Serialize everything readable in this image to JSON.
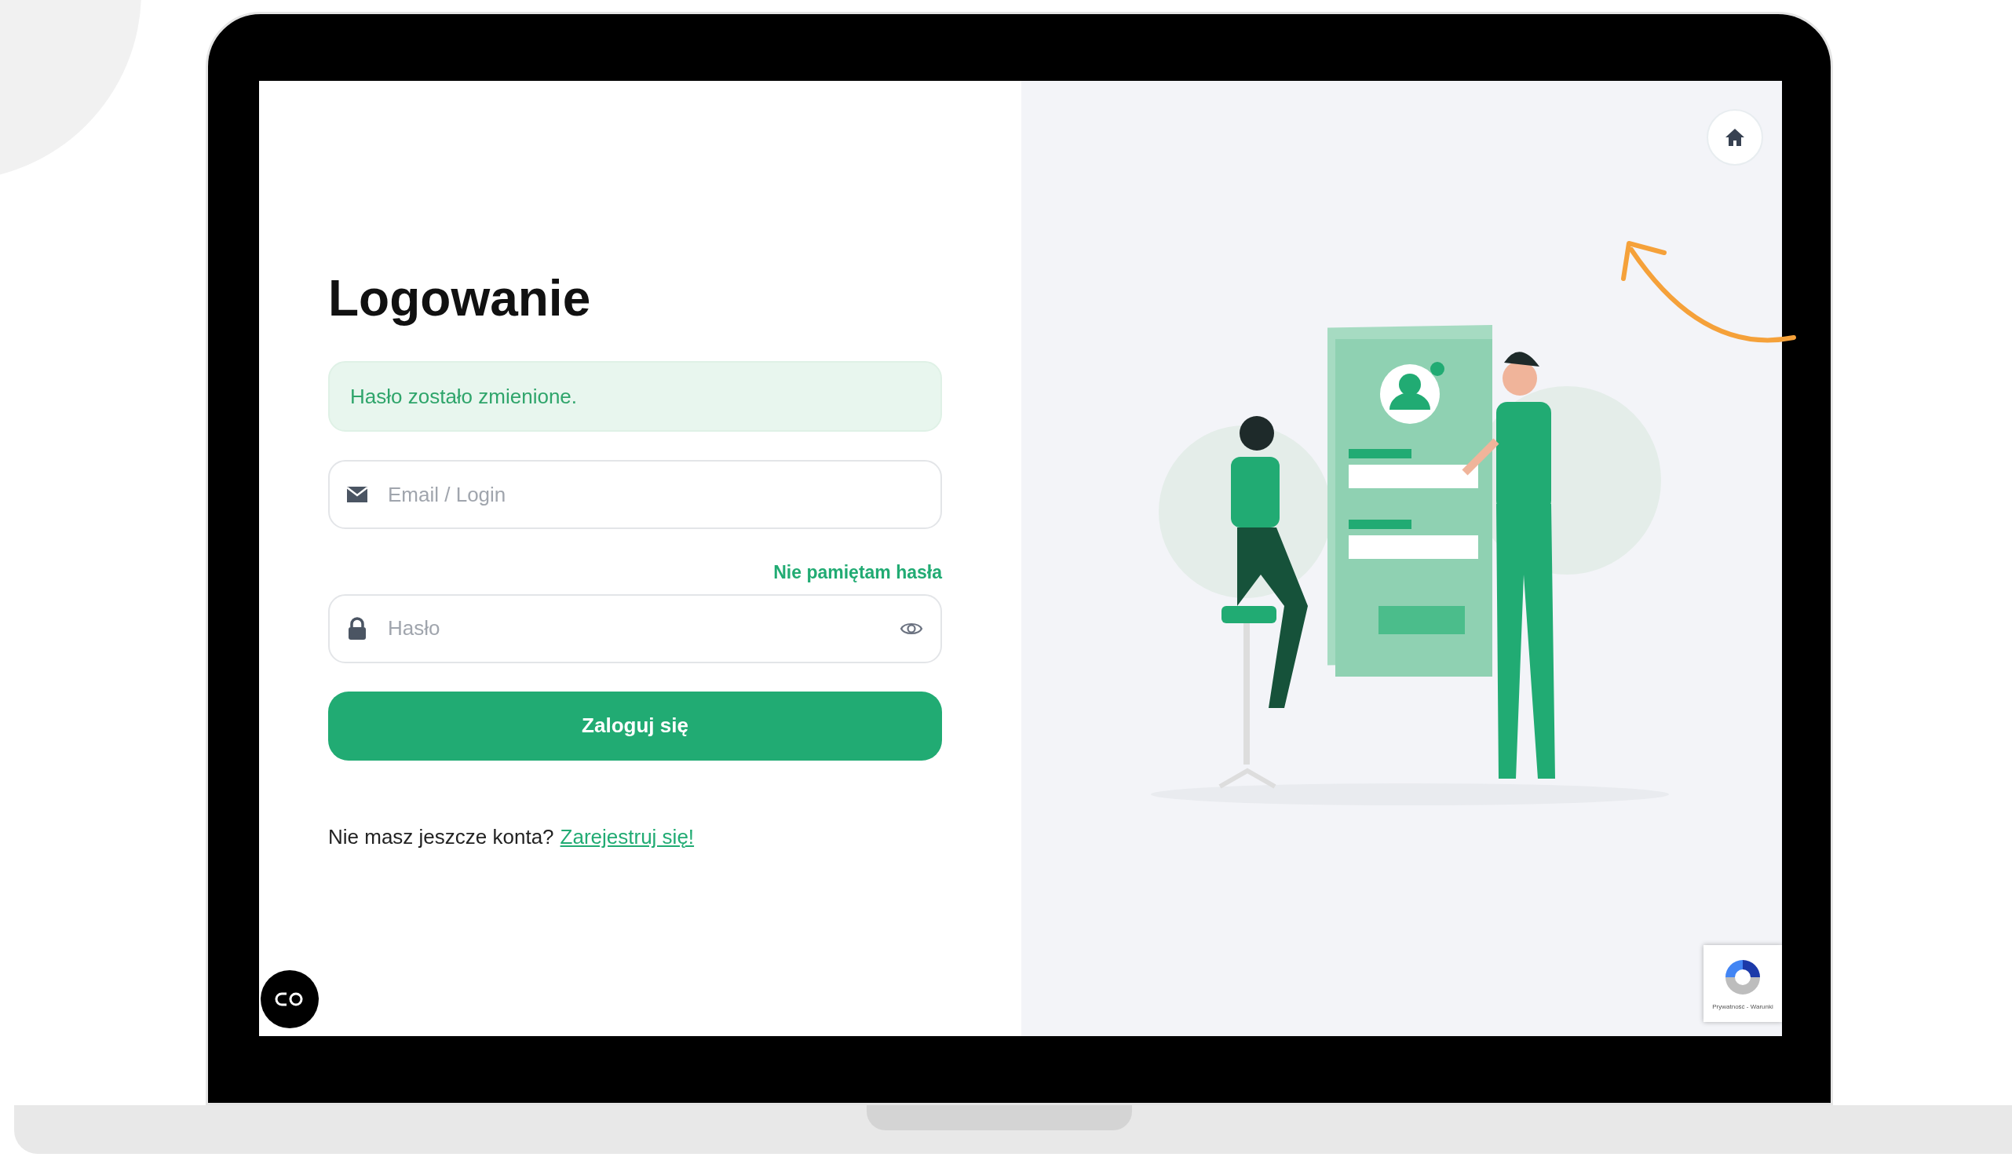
{
  "login": {
    "title": "Logowanie",
    "alert": "Hasło zostało zmienione.",
    "email": {
      "placeholder": "Email / Login"
    },
    "forgot_link": "Nie pamiętam hasła",
    "password": {
      "placeholder": "Hasło"
    },
    "submit": "Zaloguj się",
    "signup": {
      "text": "Nie masz jeszcze konta?",
      "link": "Zarejestruj się!"
    }
  },
  "recaptcha": {
    "links": "Prywatność - Warunki"
  }
}
